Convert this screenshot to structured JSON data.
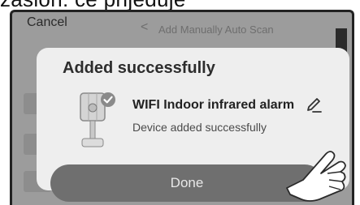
{
  "top_caption": "zaslon: če prijeduje",
  "cancel_label": "Cancel",
  "background": {
    "header_back": "<",
    "header_title": "Add Manually   Auto Scan"
  },
  "dialog": {
    "title": "Added successfully",
    "device_name": "WIFI Indoor infrared alarm",
    "device_status": "Device added successfully",
    "done_label": "Done"
  },
  "icons": {
    "device": "motion-sensor-icon",
    "status": "checkmark-badge-icon",
    "edit": "pencil-icon",
    "pointer": "hand-pointer-icon"
  },
  "colors": {
    "overlay": "#9c9c9c",
    "card": "#eeeeee",
    "done_button": "#6f6f6f"
  }
}
